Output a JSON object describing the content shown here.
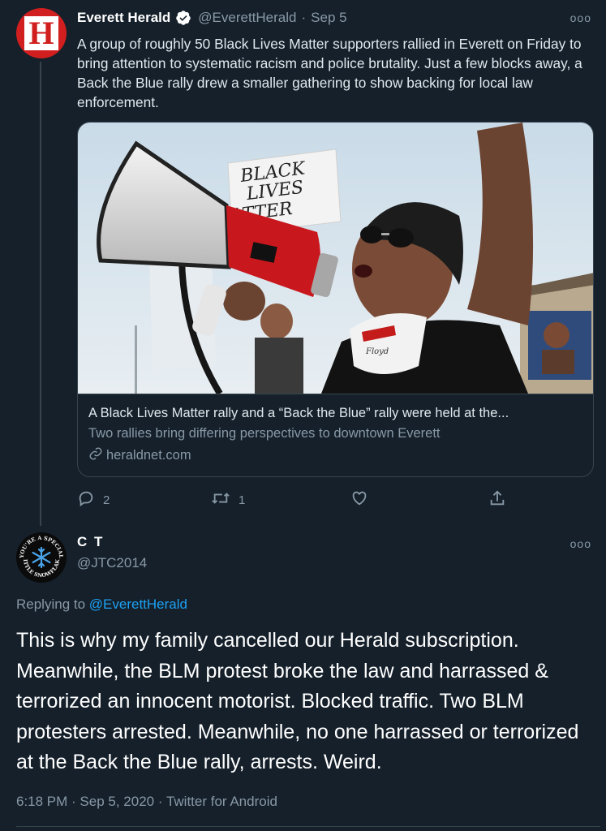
{
  "tweet": {
    "author_name": "Everett Herald",
    "handle": "@EverettHerald",
    "date": "Sep 5",
    "avatar_letter": "H",
    "more_label": "ooo",
    "text": "A group of roughly 50 Black Lives Matter supporters rallied in Everett on Friday to bring attention to systematic racism and police brutality. Just a few blocks away, a Back the Blue rally drew a smaller gathering to show backing for local law enforcement.",
    "card": {
      "sign_text": [
        "BLACK",
        "LIVES",
        "MATTER"
      ],
      "bandana_text": "Floyd",
      "title": "A Black Lives Matter rally and a “Back the Blue” rally were held at the...",
      "description": "Two rallies bring differing perspectives to downtown Everett",
      "domain": "heraldnet.com"
    },
    "actions": {
      "reply_count": "2",
      "retweet_count": "1"
    }
  },
  "reply": {
    "author_name": "C T",
    "handle": "@JTC2014",
    "more_label": "ooo",
    "replying_prefix": "Replying to",
    "replying_to": "@EverettHerald",
    "text": "This is why my family cancelled our Herald subscription. Meanwhile, the BLM protest broke the law and harrassed & terrorized an innocent motorist. Blocked traffic. Two BLM protesters arrested. Meanwhile, no one harrassed or terrorized at the Back the Blue rally, arrests. Weird.",
    "time": "6:18 PM",
    "date": "Sep 5, 2020",
    "client": "Twitter for Android",
    "avatar_top_text": "YOU'RE A SPECIAL",
    "avatar_bottom_text": "LITTLE SNOWFLAKE"
  },
  "colors": {
    "background": "#15202b",
    "accent": "#1da1f2",
    "muted": "#8899a6",
    "border": "#38444d",
    "herald_red": "#d11e1e"
  }
}
